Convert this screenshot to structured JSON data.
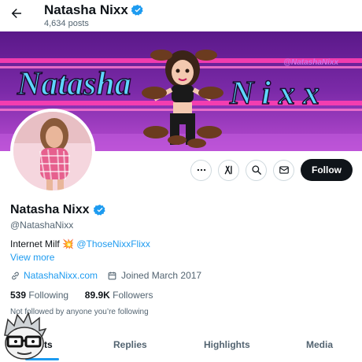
{
  "header": {
    "name": "Natasha Nixx",
    "posts": "4,634 posts"
  },
  "banner": {
    "text_left": "Natasha",
    "text_right": "Nixx",
    "handle": "@NatashaNixx",
    "colors": {
      "background": "#6a1b9a",
      "stripe": "#ff3fb0",
      "text": "#5ed6ff"
    }
  },
  "actions": {
    "follow_label": "Follow",
    "icons": [
      "more-icon",
      "grok-icon",
      "search-icon",
      "message-icon"
    ]
  },
  "profile": {
    "name": "Natasha Nixx",
    "handle": "@NatashaNixx",
    "bio_text": "Internet Milf",
    "bio_mention": "@ThoseNixxFlixx",
    "view_more": "View more",
    "website": "NatashaNixx.com",
    "joined": "Joined March 2017",
    "following_count": "539",
    "following_label": "Following",
    "followers_count": "89.9K",
    "followers_label": "Followers",
    "not_followed": "Not followed by anyone you’re following"
  },
  "tabs": [
    {
      "label": "Posts",
      "active": true
    },
    {
      "label": "Replies",
      "active": false
    },
    {
      "label": "Highlights",
      "active": false
    },
    {
      "label": "Media",
      "active": false
    }
  ],
  "colors": {
    "accent": "#1d9bf0",
    "text": "#0f1419",
    "muted": "#536471"
  }
}
